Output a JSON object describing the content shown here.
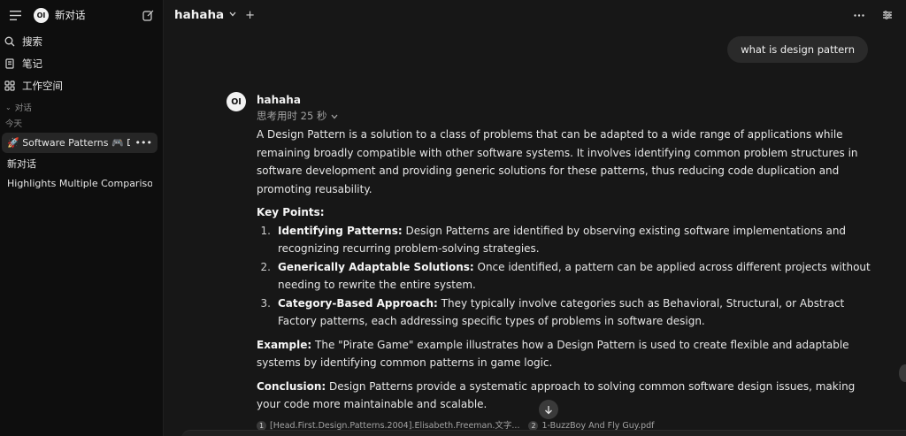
{
  "sidebar": {
    "new_chat_label": "新对话",
    "items": [
      {
        "label": "搜索",
        "icon": "search-icon"
      },
      {
        "label": "笔记",
        "icon": "notes-icon"
      },
      {
        "label": "工作空间",
        "icon": "workspace-icon"
      }
    ],
    "section_label": "对话",
    "today_label": "今天",
    "conversations": [
      {
        "title": "🚀 Software Patterns 🎮 Design",
        "active": true
      },
      {
        "title": "新对话",
        "active": false
      },
      {
        "title": "Highlights Multiple Comparisons 🌡",
        "active": false
      }
    ]
  },
  "header": {
    "model_name": "hahaha"
  },
  "chat": {
    "user_message": "what is design pattern",
    "assistant_name": "hahaha",
    "assistant_avatar_text": "OI",
    "thinking_label": "思考用时 25 秒",
    "intro": "A Design Pattern is a solution to a class of problems that can be adapted to a wide range of applications while remaining broadly compatible with other software systems. It involves identifying common problem structures in software development and providing generic solutions for these patterns, thus reducing code duplication and promoting reusability.",
    "key_points_heading": "Key Points:",
    "key_points": [
      {
        "num": "1.",
        "title": "Identifying Patterns:",
        "text": " Design Patterns are identified by observing existing software implementations and recognizing recurring problem-solving strategies."
      },
      {
        "num": "2.",
        "title": "Generically Adaptable Solutions:",
        "text": " Once identified, a pattern can be applied across different projects without needing to rewrite the entire system."
      },
      {
        "num": "3.",
        "title": "Category-Based Approach:",
        "text": " They typically involve categories such as Behavioral, Structural, or Abstract Factory patterns, each addressing specific types of problems in software design."
      }
    ],
    "example_label": "Example:",
    "example_text": " The \"Pirate Game\" example illustrates how a Design Pattern is used to create flexible and adaptable systems by identifying common patterns in game logic.",
    "conclusion_label": "Conclusion:",
    "conclusion_text": " Design Patterns provide a systematic approach to solving common software design issues, making your code more maintainable and scalable.",
    "sources": [
      {
        "num": "1",
        "name": "[Head.First.Design.Patterns.2004].Elisabeth.Freeman.文字..."
      },
      {
        "num": "2",
        "name": "1-BuzzBoy And Fly Guy.pdf"
      }
    ]
  },
  "logo_text": "OI"
}
